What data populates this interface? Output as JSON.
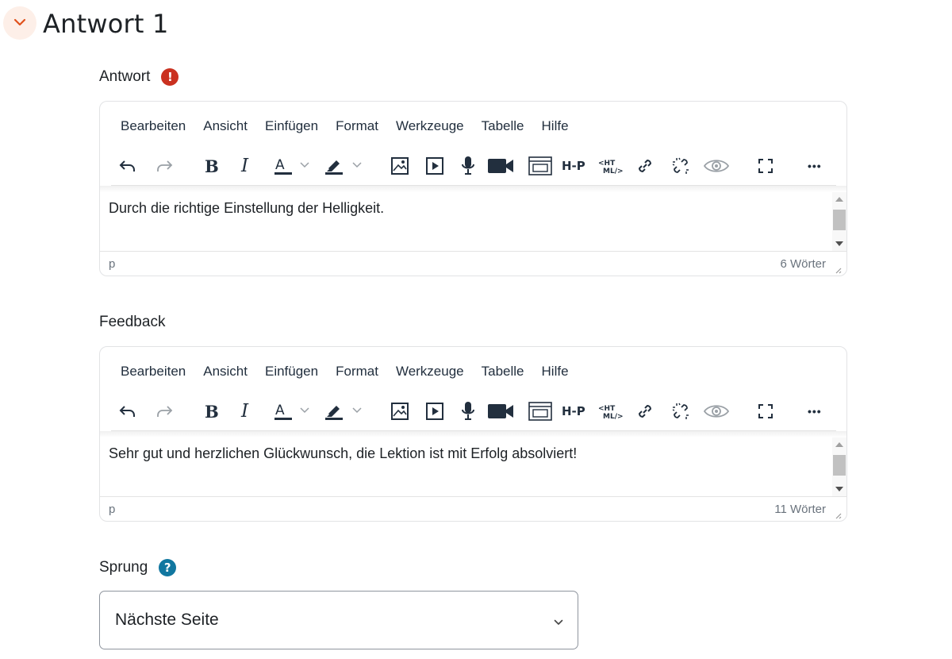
{
  "section": {
    "title": "Antwort 1"
  },
  "answer_field": {
    "label": "Antwort",
    "status_icon_symbol": "!",
    "editor": {
      "menu": [
        "Bearbeiten",
        "Ansicht",
        "Einfügen",
        "Format",
        "Werkzeuge",
        "Tabelle",
        "Hilfe"
      ],
      "content": "Durch die richtige Einstellung der Helligkeit.",
      "path": "p",
      "word_count": "6 Wörter"
    }
  },
  "feedback_field": {
    "label": "Feedback",
    "editor": {
      "menu": [
        "Bearbeiten",
        "Ansicht",
        "Einfügen",
        "Format",
        "Werkzeuge",
        "Tabelle",
        "Hilfe"
      ],
      "content": "Sehr gut und herzlichen Glückwunsch, die Lektion ist mit Erfolg absolviert!",
      "path": "p",
      "word_count": "11 Wörter"
    }
  },
  "jump_field": {
    "label": "Sprung",
    "help_icon_symbol": "?",
    "selected_value": "Nächste Seite"
  },
  "toolbar": {
    "bold": "B",
    "italic": "I",
    "text_color": "A",
    "h5p": "H-P",
    "more": "•••"
  },
  "colors": {
    "accent_orange": "#e0521c",
    "error_red": "#ca3120",
    "help_blue": "#1177a0",
    "toggle_bg": "#fdefe8"
  }
}
